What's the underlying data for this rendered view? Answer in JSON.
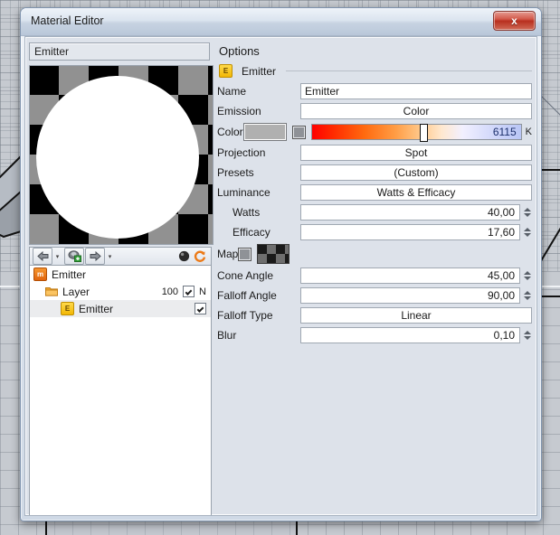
{
  "window": {
    "title": "Material Editor",
    "close_label": "x"
  },
  "left": {
    "name_value": "Emitter",
    "toolbar": {
      "back_icon": "back-arrow-icon",
      "back_caret": "▾",
      "add_layer_icon": "add-layer-icon",
      "forward_icon": "forward-arrow-icon",
      "forward_caret": "▾",
      "sphere_icon": "preview-sphere-icon",
      "refresh_icon": "refresh-icon"
    },
    "tree": [
      {
        "label": "Emitter",
        "icon": "material-icon",
        "badge": "m",
        "depth": 0,
        "value": "",
        "flag": "",
        "checked": false,
        "selected": false
      },
      {
        "label": "Layer",
        "icon": "folder-icon",
        "badge": "",
        "depth": 1,
        "value": "100",
        "flag": "N",
        "checked": true,
        "selected": false
      },
      {
        "label": "Emitter",
        "icon": "emitter-icon",
        "badge": "E",
        "depth": 2,
        "value": "",
        "flag": "",
        "checked": true,
        "selected": true
      }
    ]
  },
  "options": {
    "panel_title": "Options",
    "section": {
      "badge": "E",
      "title": "Emitter"
    },
    "rows": {
      "name": {
        "label": "Name",
        "value": "Emitter"
      },
      "emission": {
        "label": "Emission",
        "value": "Color"
      },
      "color": {
        "label": "Color",
        "swatch_color": "#b0b0b0",
        "kelvin": "6115",
        "unit": "K"
      },
      "projection": {
        "label": "Projection",
        "value": "Spot"
      },
      "presets": {
        "label": "Presets",
        "value": "(Custom)"
      },
      "luminance": {
        "label": "Luminance",
        "value": "Watts & Efficacy"
      },
      "watts": {
        "label": "Watts",
        "value": "40,00"
      },
      "efficacy": {
        "label": "Efficacy",
        "value": "17,60"
      },
      "map": {
        "label": "Map"
      },
      "cone_angle": {
        "label": "Cone Angle",
        "value": "45,00"
      },
      "falloff_angle": {
        "label": "Falloff Angle",
        "value": "90,00"
      },
      "falloff_type": {
        "label": "Falloff Type",
        "value": "Linear"
      },
      "blur": {
        "label": "Blur",
        "value": "0,10"
      }
    }
  }
}
